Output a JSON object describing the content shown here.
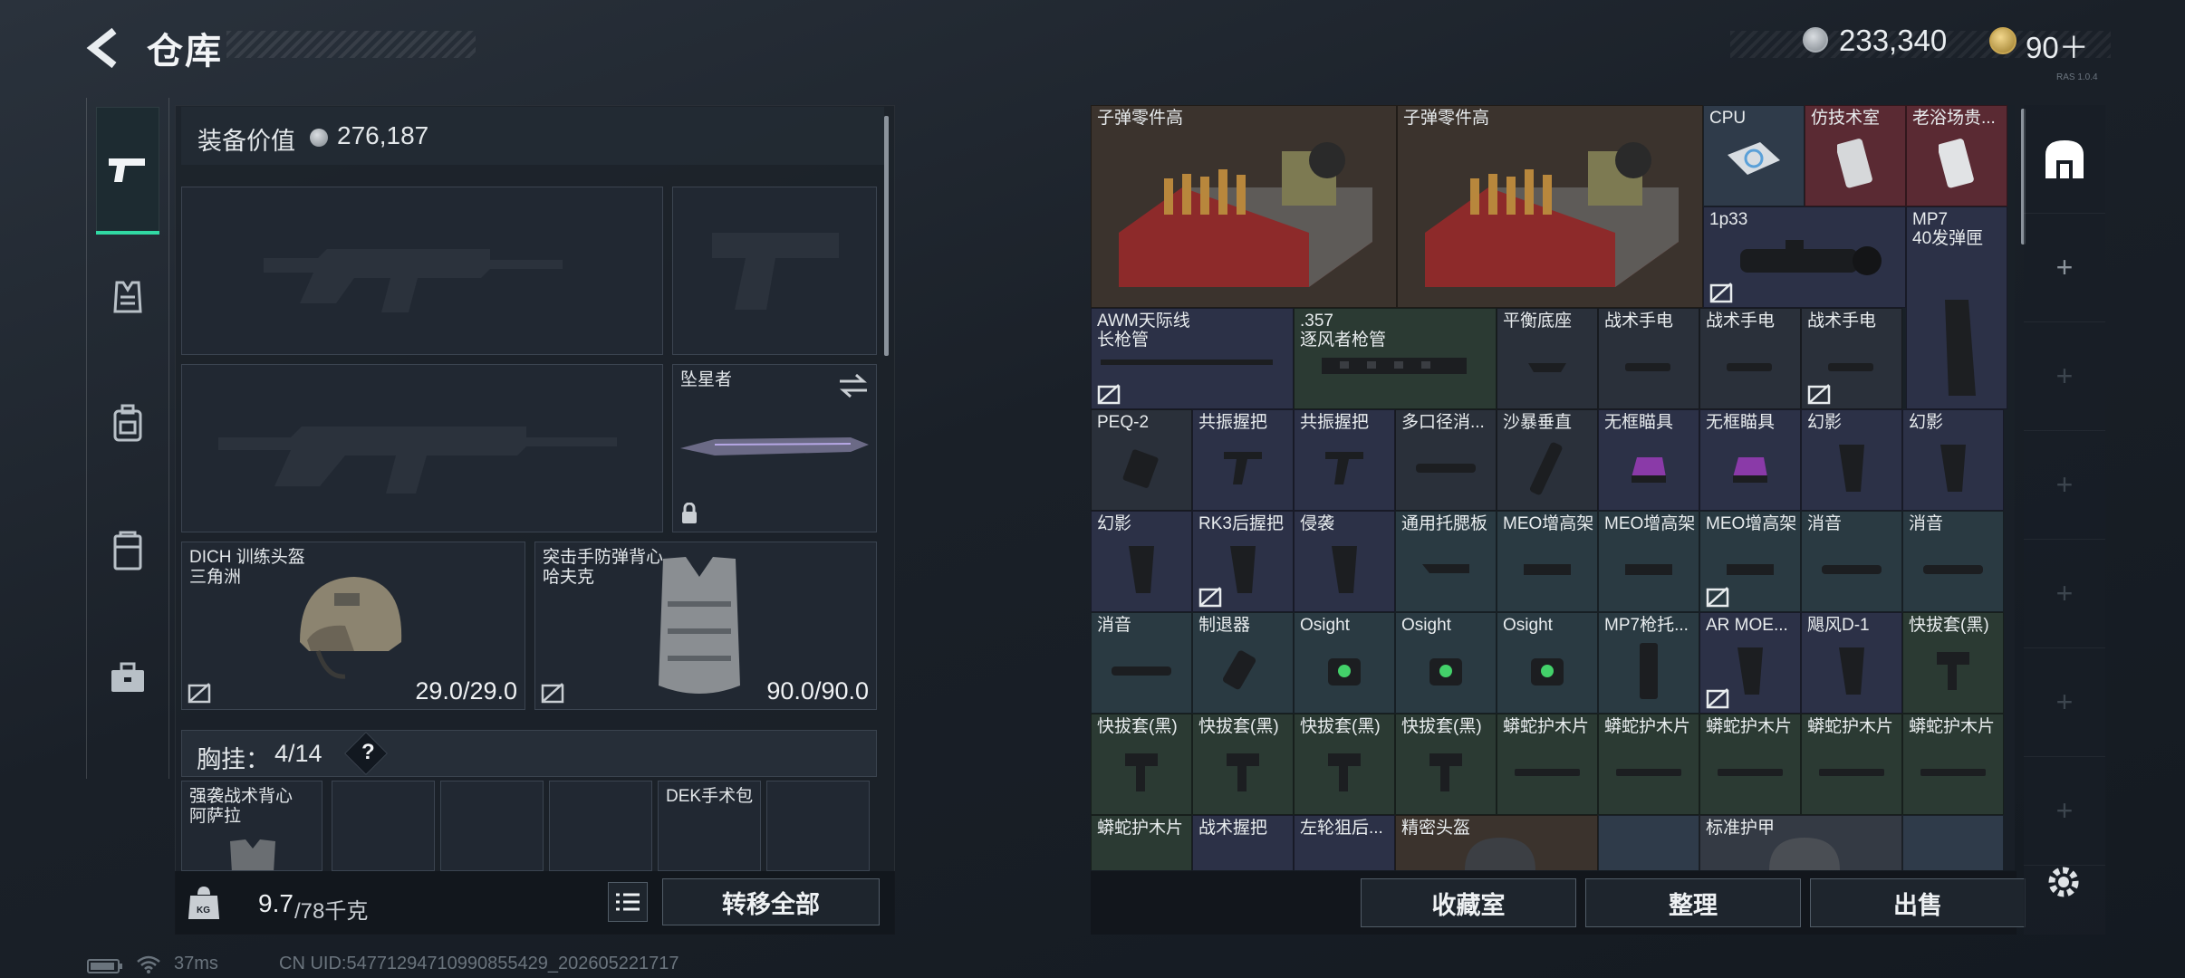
{
  "header": {
    "title": "仓库",
    "currency": "233,340",
    "tokens": "90＋"
  },
  "equip": {
    "value_label": "装备价值",
    "value": "276,187",
    "melee_name": "坠星者",
    "helmet": {
      "name": "DICH 训练头盔",
      "sub": "三角洲",
      "durability": "29.0/29.0"
    },
    "armor": {
      "name": "突击手防弹背心",
      "sub": "哈夫克",
      "durability": "90.0/90.0"
    },
    "chest_label": "胸挂：",
    "chest_count": "4/14",
    "help": "?",
    "chest_rig": {
      "name": "强袭战术背心",
      "sub": "阿萨拉"
    },
    "pouch_name": "DEK手术包",
    "weight": "9.7",
    "weight_max": "/78千克",
    "transfer_all": "转移全部"
  },
  "stash": {
    "items": [
      {
        "name": "子弹零件高"
      },
      {
        "name": "子弹零件高"
      },
      {
        "name": "CPU"
      },
      {
        "name": "仿技术室"
      },
      {
        "name": "老浴场贵..."
      },
      {
        "name": "1p33"
      },
      {
        "name": "MP7"
      },
      {
        "name": "40发弹匣"
      },
      {
        "name": "AWM天际线"
      },
      {
        "name": "长枪管"
      },
      {
        "name": ".357"
      },
      {
        "name": "逐风者枪管"
      },
      {
        "name": "平衡底座"
      },
      {
        "name": "战术手电"
      },
      {
        "name": "战术手电"
      },
      {
        "name": "战术手电"
      },
      {
        "name": "PEQ-2"
      },
      {
        "name": "共振握把"
      },
      {
        "name": "共振握把"
      },
      {
        "name": "多口径消..."
      },
      {
        "name": "沙暴垂直"
      },
      {
        "name": "无框瞄具"
      },
      {
        "name": "无框瞄具"
      },
      {
        "name": "幻影"
      },
      {
        "name": "幻影"
      },
      {
        "name": "幻影"
      },
      {
        "name": "RK3后握把"
      },
      {
        "name": "侵袭"
      },
      {
        "name": "通用托腮板"
      },
      {
        "name": "MEO增高架"
      },
      {
        "name": "MEO增高架"
      },
      {
        "name": "MEO增高架"
      },
      {
        "name": "消音"
      },
      {
        "name": "消音"
      },
      {
        "name": "消音"
      },
      {
        "name": "制退器"
      },
      {
        "name": "Osight"
      },
      {
        "name": "Osight"
      },
      {
        "name": "Osight"
      },
      {
        "name": "MP7枪托..."
      },
      {
        "name": "AR MOE..."
      },
      {
        "name": "飓风D-1"
      },
      {
        "name": "快拔套(黑)"
      },
      {
        "name": "快拔套(黑)"
      },
      {
        "name": "快拔套(黑)"
      },
      {
        "name": "快拔套(黑)"
      },
      {
        "name": "快拔套(黑)"
      },
      {
        "name": "蟒蛇护木片"
      },
      {
        "name": "蟒蛇护木片"
      },
      {
        "name": "蟒蛇护木片"
      },
      {
        "name": "蟒蛇护木片"
      },
      {
        "name": "蟒蛇护木片"
      },
      {
        "name": "蟒蛇护木片"
      },
      {
        "name": "战术握把"
      },
      {
        "name": "左轮狙后..."
      },
      {
        "name": "精密头盔"
      },
      {
        "name": "标准护甲"
      }
    ],
    "collection": "收藏室",
    "sort": "整理",
    "sell": "出售"
  },
  "status": {
    "ping": "37ms",
    "uid": "CN UID:547712947109908554​29_202605221717",
    "version": "RAS 1.0.4"
  }
}
